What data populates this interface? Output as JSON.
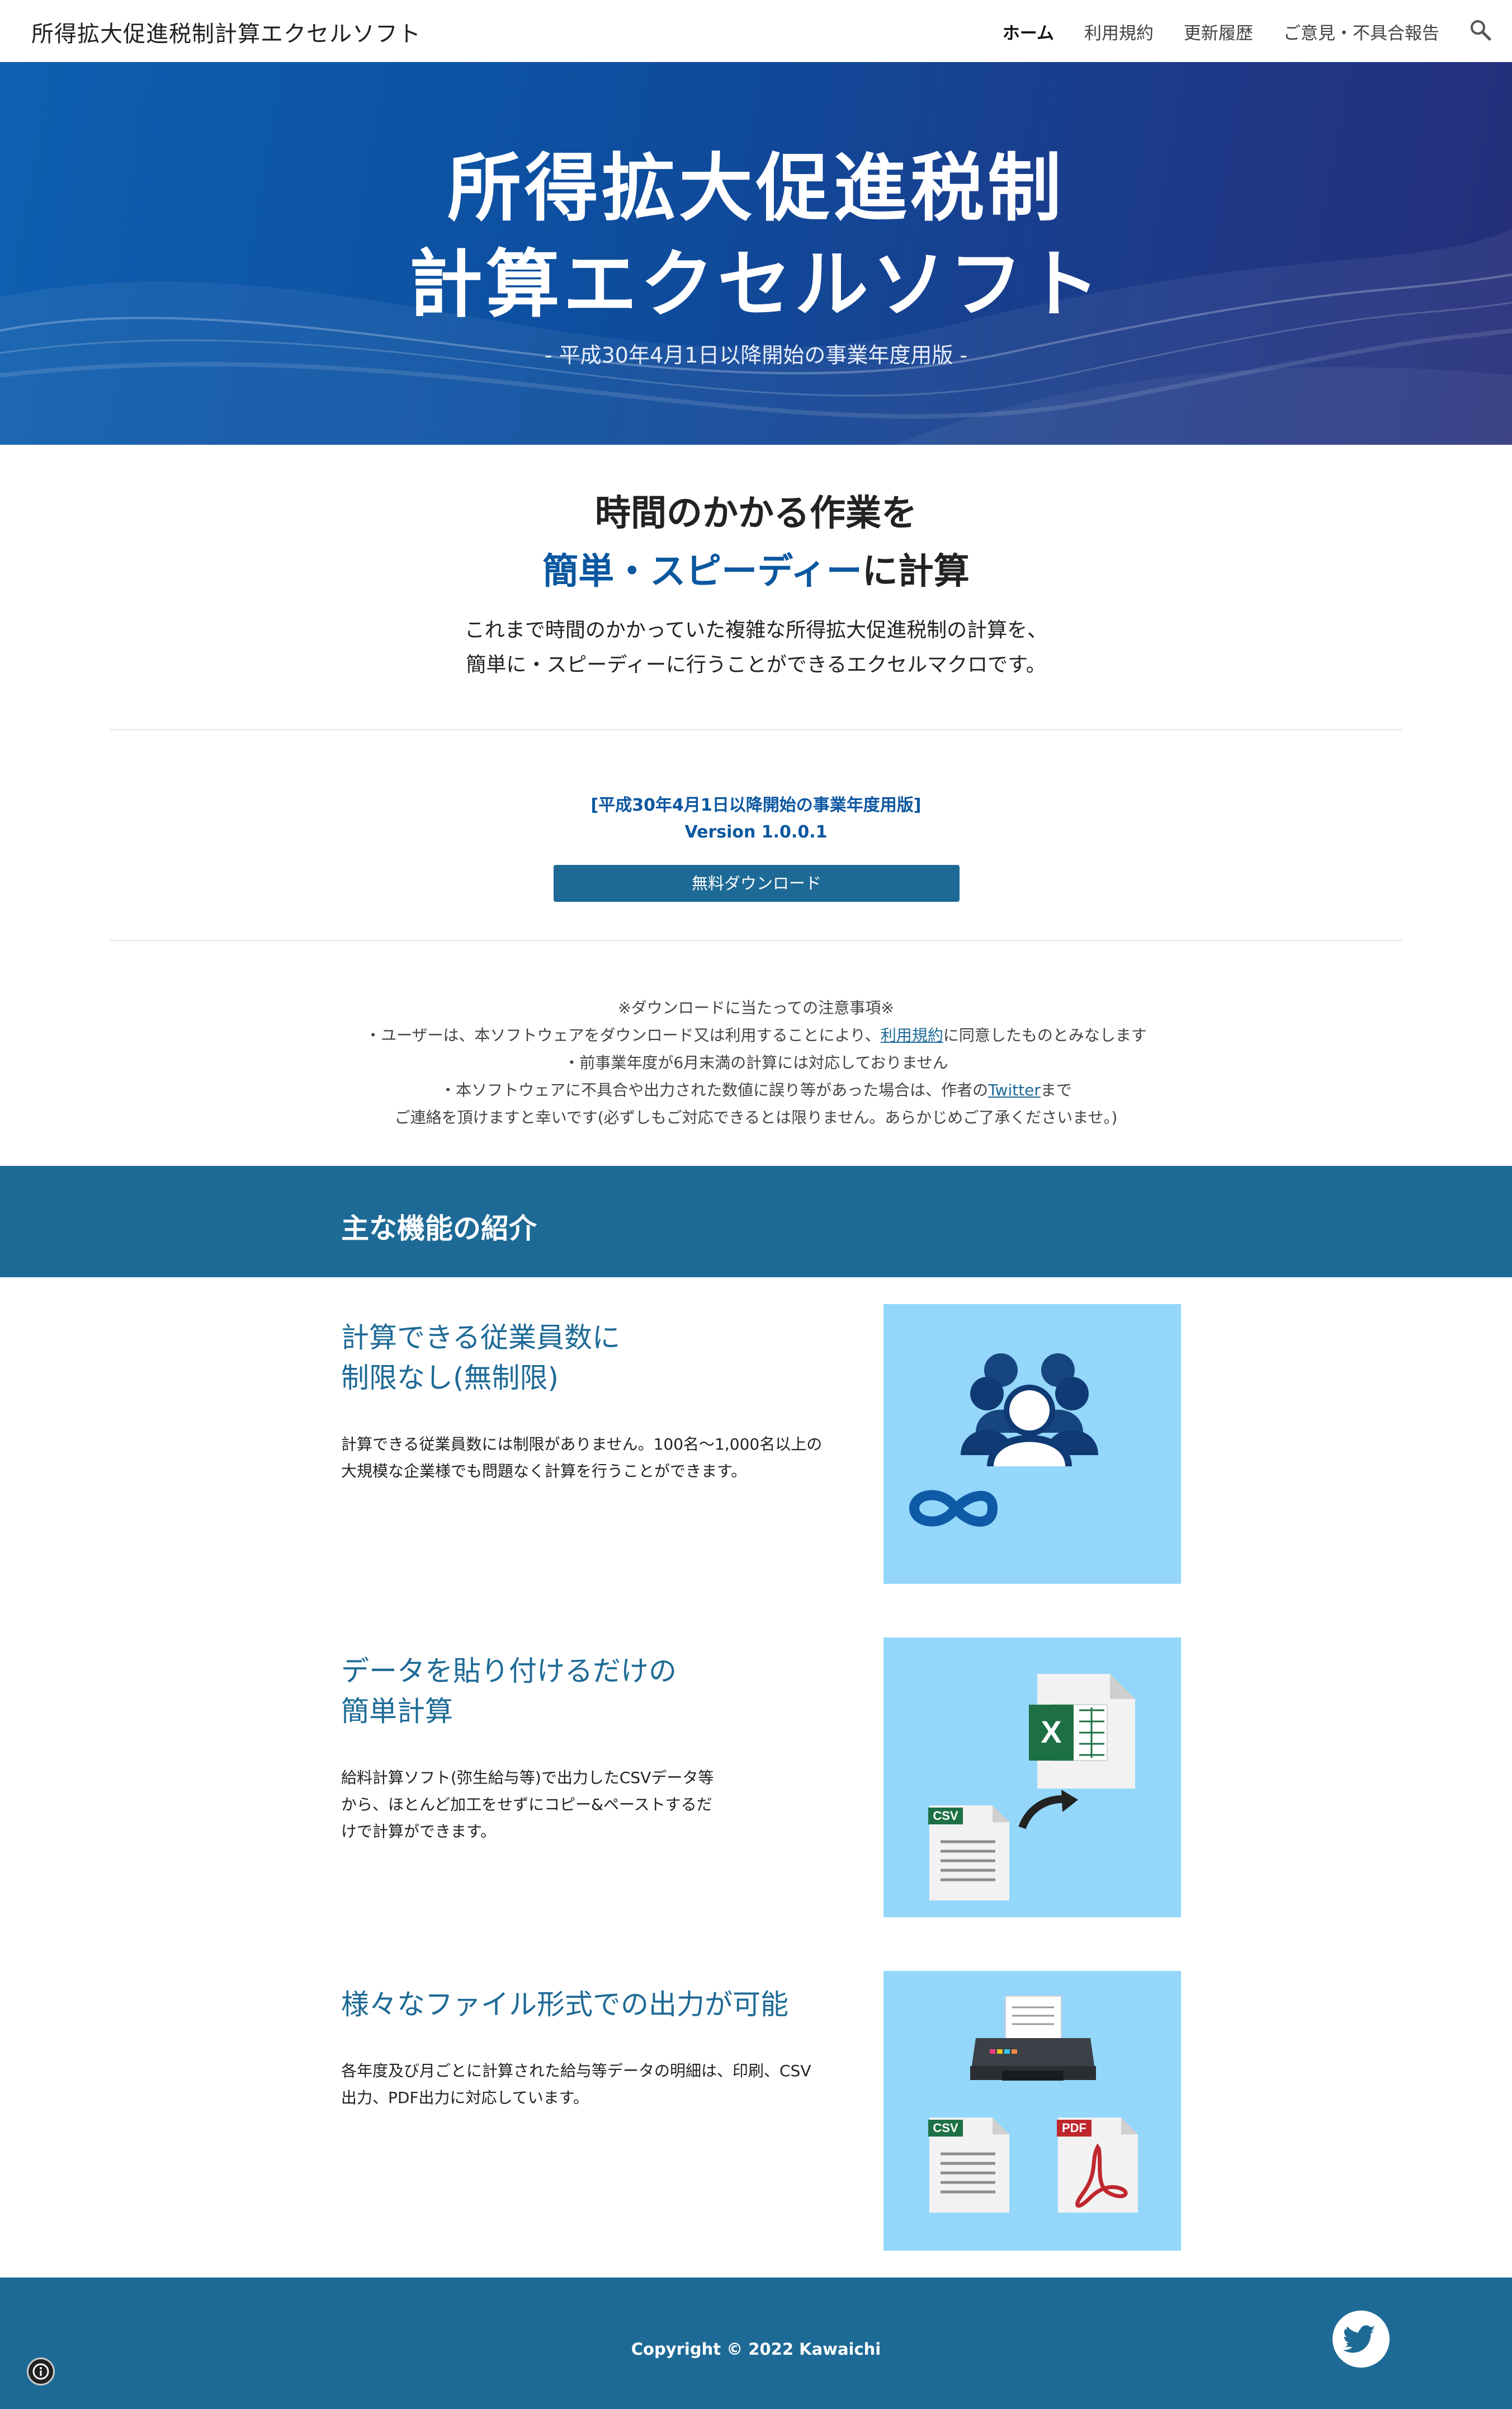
{
  "header": {
    "site_title": "所得拡大促進税制計算エクセルソフト",
    "nav": [
      "ホーム",
      "利用規約",
      "更新履歴",
      "ご意見・不具合報告"
    ],
    "search_icon": "search-icon"
  },
  "hero": {
    "title_line1": "所得拡大促進税制",
    "title_line2": "計算エクセルソフト",
    "subtitle": "- 平成30年4月1日以降開始の事業年度用版 -"
  },
  "intro": {
    "heading_line1": "時間のかかる作業を",
    "heading_line2_highlight": "簡単・スピーディー",
    "heading_line2_rest": "に計算",
    "paragraph_line1": "これまで時間のかかっていた複雑な所得拡大促進税制の計算を、",
    "paragraph_line2": "簡単に・スピーディーに行うことができるエクセルマクロです。"
  },
  "download": {
    "edition": "[平成30年4月1日以降開始の事業年度用版]",
    "version": "Version 1.0.0.1",
    "button_label": "無料ダウンロード"
  },
  "notes": {
    "title": "※ダウンロードに当たっての注意事項※",
    "line1_pre": "・ユーザーは、本ソフトウェアをダウンロード又は利用することにより、",
    "line1_link": "利用規約",
    "line1_post": "に同意したものとみなします",
    "line2": "・前事業年度が6月末満の計算には対応しておりません",
    "line3_pre": "・本ソフトウェアに不具合や出力された数値に誤り等があった場合は、作者の",
    "line3_link": "Twitter",
    "line3_post": "まで",
    "line4": "ご連絡を頂けますと幸いです(必ずしもご対応できるとは限りません。あらかじめご了承くださいませ。)"
  },
  "features": {
    "section_title": "主な機能の紹介",
    "items": [
      {
        "title_line1": "計算できる従業員数に",
        "title_line2": "制限なし(無制限)",
        "text_line1": "計算できる従業員数には制限がありません。100名〜1,000名以上の",
        "text_line2": "大規模な企業様でも問題なく計算を行うことができます。",
        "text_line3": "",
        "icon": "people-infinity-icon"
      },
      {
        "title_line1": "データを貼り付けるだけの",
        "title_line2": "簡単計算",
        "text_line1": "給料計算ソフト(弥生給与等)で出力したCSVデータ等",
        "text_line2": "から、ほとんど加工をせずにコピー&ペーストするだ",
        "text_line3": "けで計算ができます。",
        "icon": "csv-to-excel-icon",
        "csv_label": "CSV",
        "excel_label": "X"
      },
      {
        "title_line1": "様々なファイル形式での出力が可能",
        "title_line2": "",
        "text_line1": "各年度及び月ごとに計算された給与等データの明細は、印刷、CSV",
        "text_line2": "出力、PDF出力に対応しています。",
        "text_line3": "",
        "icon": "printer-csv-pdf-icon",
        "csv_label": "CSV",
        "pdf_label": "PDF"
      }
    ]
  },
  "footer": {
    "copyright": "Copyright © 2022 Kawaichi",
    "twitter_icon": "twitter-icon",
    "info_icon": "info-icon"
  },
  "colors": {
    "accent": "#1e6a96",
    "hero_blue": "#0d4e9f",
    "feature_bg": "#94d7fb",
    "heading_blue": "#0b57a0"
  }
}
